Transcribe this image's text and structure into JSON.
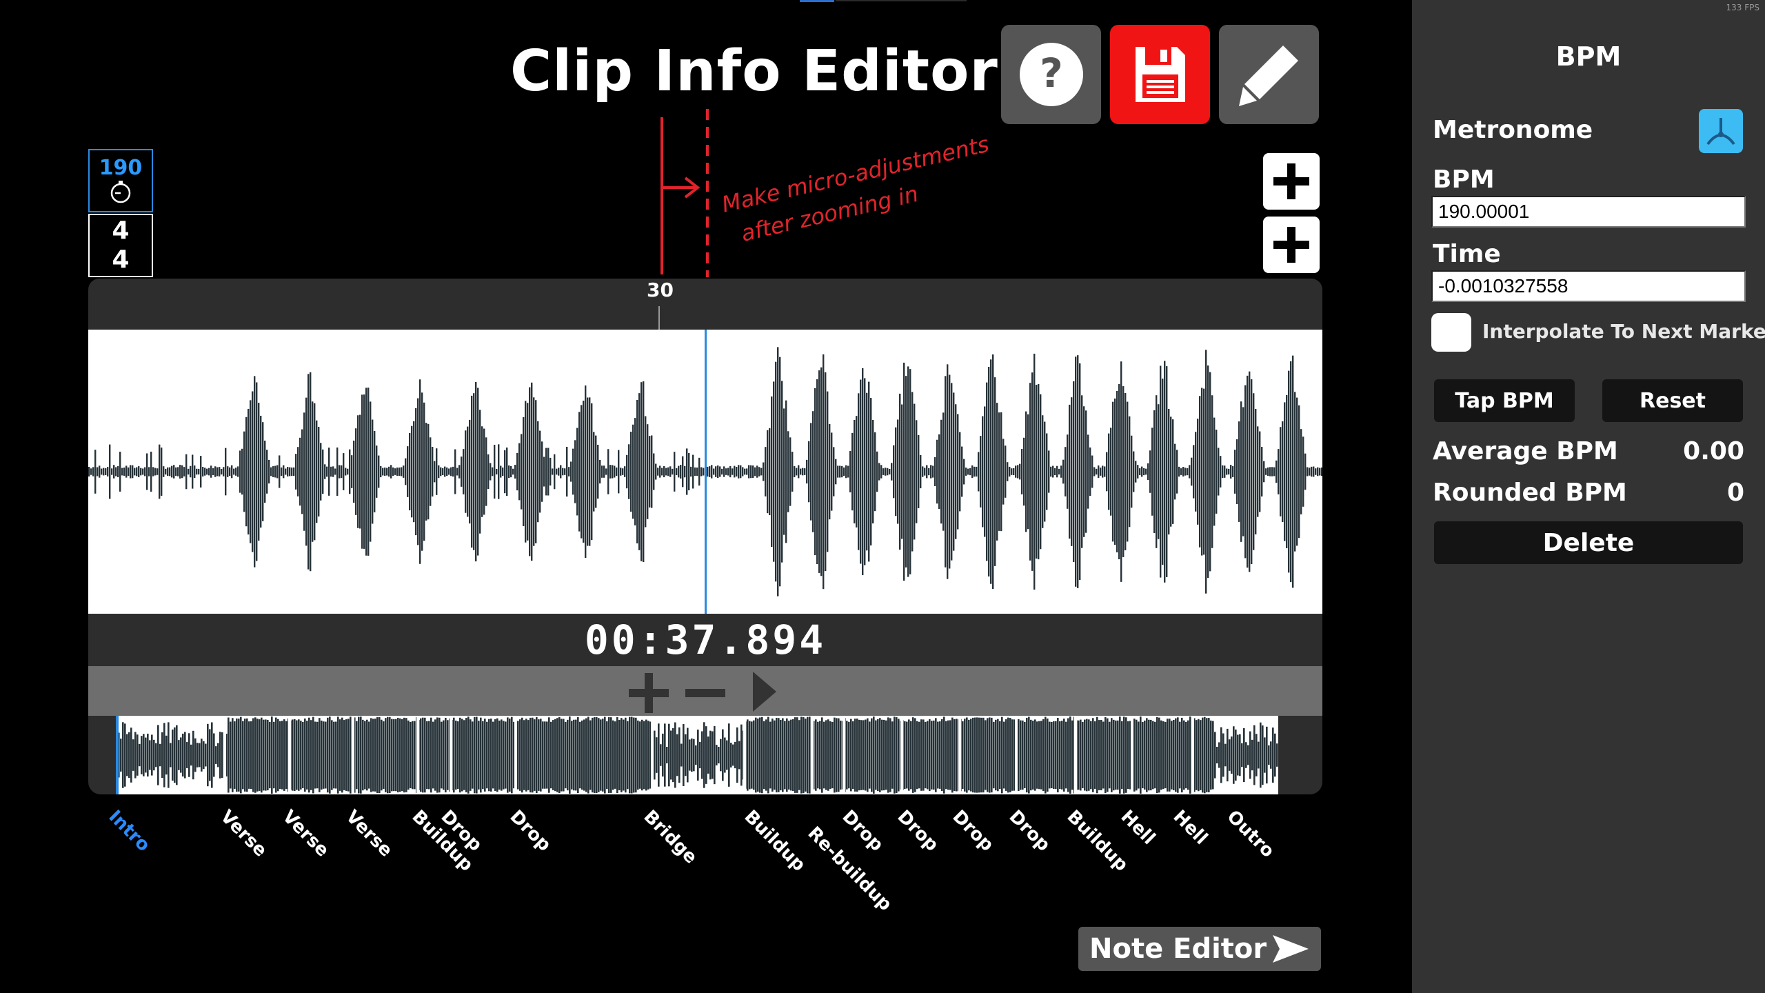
{
  "app": {
    "title": "Clip Info Editor",
    "fps": "133 FPS"
  },
  "toolbar": {
    "help_icon": "question-icon",
    "save_icon": "floppy-disk-icon",
    "edit_icon": "pencil-icon",
    "save_color": "#f01414"
  },
  "signature": {
    "bpm": "190",
    "beats": "4",
    "unit": "4"
  },
  "ruler": {
    "marker": "30"
  },
  "annotation": {
    "line1": "Make micro-adjustments",
    "line2": "after zooming in",
    "color": "#e0242c"
  },
  "timecode": "00:37.894",
  "sections": [
    {
      "label": "Intro",
      "active": true
    },
    {
      "label": "Verse",
      "active": false
    },
    {
      "label": "Verse",
      "active": false
    },
    {
      "label": "Verse",
      "active": false
    },
    {
      "label": "Buildup",
      "active": false
    },
    {
      "label": "Drop",
      "active": false
    },
    {
      "label": "Drop",
      "active": false
    },
    {
      "label": "Bridge",
      "active": false
    },
    {
      "label": "Buildup",
      "active": false
    },
    {
      "label": "Re-buildup",
      "active": false
    },
    {
      "label": "Drop",
      "active": false
    },
    {
      "label": "Drop",
      "active": false
    },
    {
      "label": "Drop",
      "active": false
    },
    {
      "label": "Drop",
      "active": false
    },
    {
      "label": "Buildup",
      "active": false
    },
    {
      "label": "Hell",
      "active": false
    },
    {
      "label": "Hell",
      "active": false
    },
    {
      "label": "Outro",
      "active": false
    }
  ],
  "note_editor": {
    "label": "Note Editor"
  },
  "sidebar": {
    "title": "BPM",
    "metronome_label": "Metronome",
    "bpm_label": "BPM",
    "bpm_value": "190.00001",
    "time_label": "Time",
    "time_value": "-0.0010327558",
    "interpolate_label": "Interpolate To Next Marker",
    "tap_label": "Tap BPM",
    "reset_label": "Reset",
    "avg_label": "Average BPM",
    "avg_value": "0.00",
    "rounded_label": "Rounded BPM",
    "rounded_value": "0",
    "delete_label": "Delete",
    "accent": "#3cbcf2"
  }
}
